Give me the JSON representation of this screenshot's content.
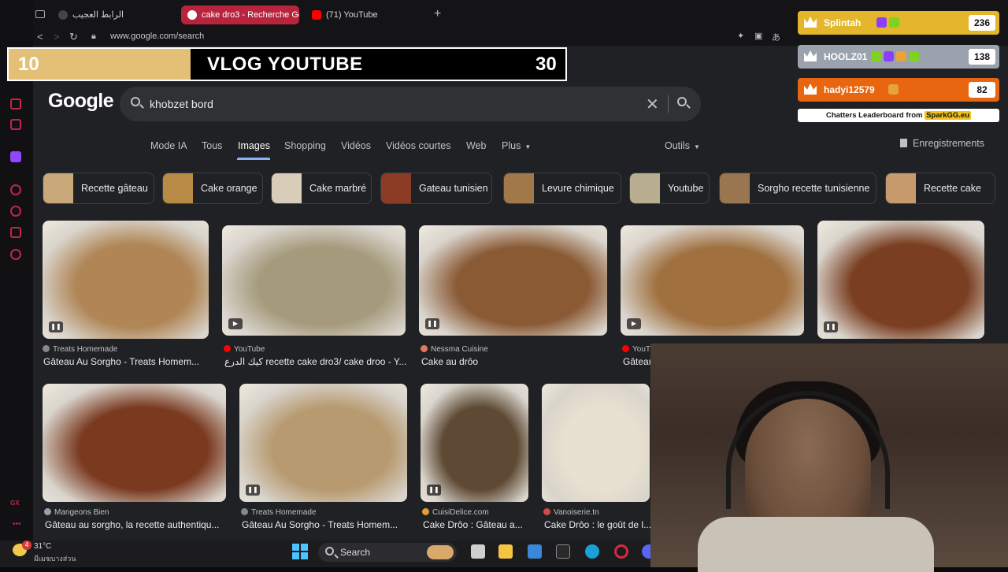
{
  "browser": {
    "tabs": [
      {
        "label": "الرابط العجيب"
      },
      {
        "label": "cake dro3 - Recherche Go"
      },
      {
        "label": "(71) YouTube"
      }
    ],
    "url": "www.google.com/search"
  },
  "google": {
    "logo": "Google",
    "query": "khobzet bord",
    "nav_tabs": [
      "Mode IA",
      "Tous",
      "Images",
      "Shopping",
      "Vidéos",
      "Vidéos courtes",
      "Web",
      "Plus"
    ],
    "tools_label": "Outils",
    "saved_label": "Enregistrements",
    "chips": [
      {
        "label": "Recette gâteau",
        "color": "#c9a87a"
      },
      {
        "label": "Cake orange",
        "color": "#b78a45"
      },
      {
        "label": "Cake marbré",
        "color": "#d8cdb8"
      },
      {
        "label": "Gateau tunisien",
        "color": "#8c3b24"
      },
      {
        "label": "Levure chimique",
        "color": "#a0784a"
      },
      {
        "label": "Youtube",
        "color": "#b9ae90"
      },
      {
        "label": "Sorgho recette tunisienne",
        "color": "#9a7650"
      },
      {
        "label": "Recette cake",
        "color": "#c69a6c"
      }
    ],
    "results": [
      {
        "source": "Treats Homemade",
        "title": "Gâteau Au Sorgho - Treats Homem...",
        "badge": "❚❚",
        "src_color": "#888888",
        "img_color": "#b08656"
      },
      {
        "source": "YouTube",
        "title": "كيك الدرع recette cake dro3/ cake droo - Y...",
        "badge": "▶",
        "src_color": "#ff0000",
        "img_color": "#a59a7c"
      },
      {
        "source": "Nessma Cuisine",
        "title": "Cake au drôo",
        "badge": "❚❚",
        "src_color": "#e07a5f",
        "img_color": "#8a5a35"
      },
      {
        "source": "YouTube",
        "title": "Gâteau",
        "badge": "▶",
        "src_color": "#ff0000",
        "img_color": "#a0703f"
      },
      {
        "source": "",
        "title": "",
        "badge": "❚❚",
        "src_color": "#888888",
        "img_color": "#7a3f22"
      },
      {
        "source": "Mangeons Bien",
        "title": "Gâteau au sorgho, la recette authentiqu...",
        "badge": "",
        "src_color": "#9aa0a6",
        "img_color": "#7a3a20"
      },
      {
        "source": "Treats Homemade",
        "title": "Gâteau Au Sorgho - Treats Homem...",
        "badge": "❚❚",
        "src_color": "#888888",
        "img_color": "#b79a70"
      },
      {
        "source": "CuisiDelice.com",
        "title": "Cake Drôo : Gâteau a...",
        "badge": "❚❚",
        "src_color": "#e0a030",
        "img_color": "#5e4a34"
      },
      {
        "source": "Vanoiserie.tn",
        "title": "Cake Drôo : le goût de l...",
        "badge": "",
        "src_color": "#d04a4a",
        "img_color": "#e8e0d0"
      }
    ]
  },
  "overlay": {
    "vlog": {
      "left_num": "10",
      "title": "VLOG YOUTUBE",
      "right_num": "30"
    },
    "leaderboard": [
      {
        "name": "Splintah",
        "score": "236",
        "color": "#e3b62b"
      },
      {
        "name": "HOOLZ01",
        "score": "138",
        "color": "#9aa3ad"
      },
      {
        "name": "hadyi12579",
        "score": "82",
        "color": "#e8660f"
      }
    ],
    "leaderboard_footer": "Chatters Leaderboard from",
    "leaderboard_brand": "SparkGG.eu"
  },
  "taskbar": {
    "temperature": "31°C",
    "weather": "มีเมฆบางส่วน",
    "weather_badge": "4",
    "search_label": "Search"
  }
}
